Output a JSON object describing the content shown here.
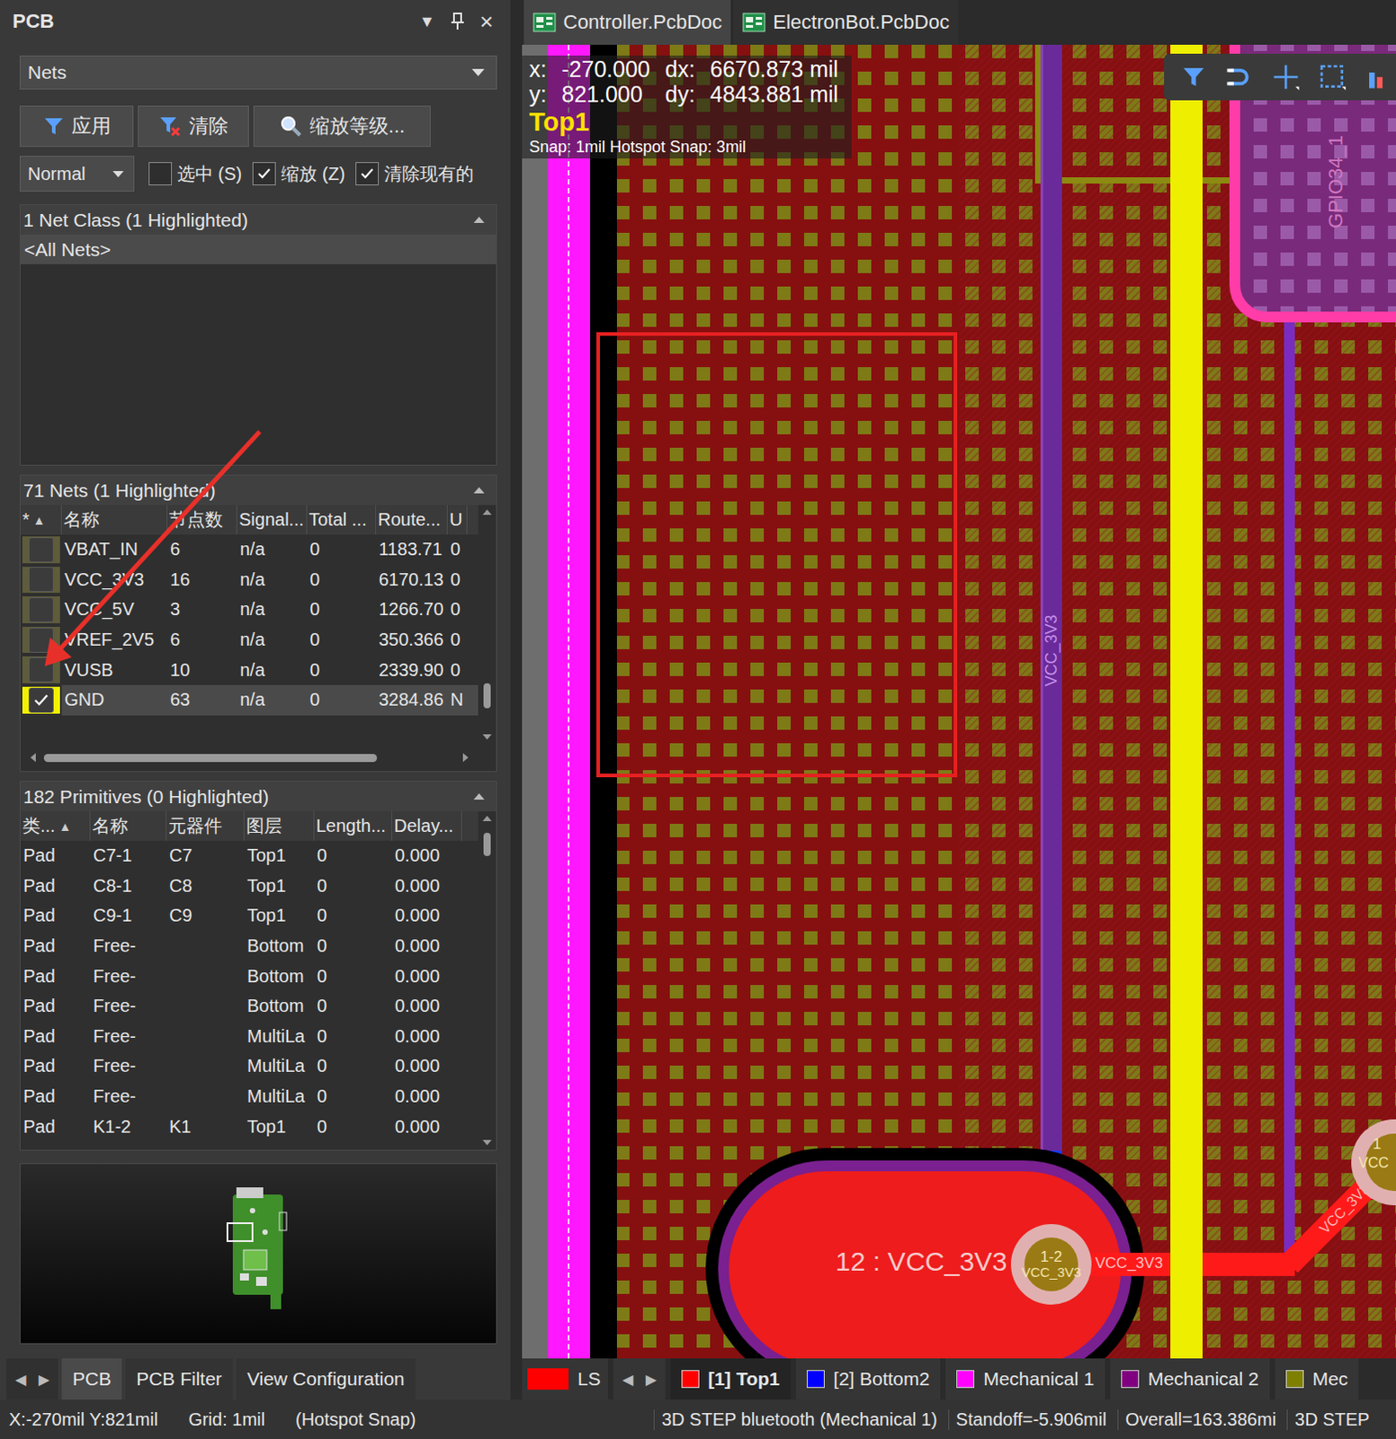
{
  "panel": {
    "title": "PCB",
    "menu_glyph": "▼",
    "close_glyph": "×"
  },
  "mode_dropdown": {
    "value": "Nets"
  },
  "actions": [
    {
      "label": "应用",
      "kind": "filter"
    },
    {
      "label": "清除",
      "kind": "clear"
    },
    {
      "label": "缩放等级...",
      "kind": "zoom"
    }
  ],
  "mask_mode": {
    "value": "Normal"
  },
  "options": [
    {
      "label": "选中 (S)",
      "checked": false
    },
    {
      "label": "缩放 (Z)",
      "checked": true
    },
    {
      "label": "清除现有的",
      "checked": true
    }
  ],
  "net_class_panel": {
    "header": "1 Net Class (1 Highlighted)",
    "items": [
      {
        "label": "<All Nets>",
        "selected": true
      }
    ]
  },
  "nets_panel": {
    "header": "71 Nets (1 Highlighted)",
    "sort_glyph": "▲",
    "columns": [
      {
        "label": "*",
        "sorted": true
      },
      {
        "label": "名称",
        "sorted": false
      },
      {
        "label": "节点数",
        "sorted": false
      },
      {
        "label": "Signal...",
        "sorted": false
      },
      {
        "label": "Total ...",
        "sorted": false
      },
      {
        "label": "Route...",
        "sorted": false
      },
      {
        "label": "U",
        "sorted": false
      }
    ],
    "rows": [
      {
        "cells": [
          "VBAT_IN",
          "6",
          "n/a",
          "0",
          "1183.71",
          "0"
        ],
        "checked": false,
        "selected": false
      },
      {
        "cells": [
          "VCC_3V3",
          "16",
          "n/a",
          "0",
          "6170.13",
          "0"
        ],
        "checked": false,
        "selected": false
      },
      {
        "cells": [
          "VCC_5V",
          "3",
          "n/a",
          "0",
          "1266.70",
          "0"
        ],
        "checked": false,
        "selected": false
      },
      {
        "cells": [
          "VREF_2V5",
          "6",
          "n/a",
          "0",
          "350.366",
          "0"
        ],
        "checked": false,
        "selected": false
      },
      {
        "cells": [
          "VUSB",
          "10",
          "n/a",
          "0",
          "2339.90",
          "0"
        ],
        "checked": false,
        "selected": false
      },
      {
        "cells": [
          "GND",
          "63",
          "n/a",
          "0",
          "3284.86",
          "N"
        ],
        "checked": true,
        "selected": true
      }
    ]
  },
  "primitives_panel": {
    "header": "182 Primitives (0 Highlighted)",
    "sort_glyph": "▲",
    "columns": [
      {
        "label": "类...",
        "sorted": true
      },
      {
        "label": "名称",
        "sorted": false
      },
      {
        "label": "元器件",
        "sorted": false
      },
      {
        "label": "图层",
        "sorted": false
      },
      {
        "label": "Length...",
        "sorted": false
      },
      {
        "label": "Delay...",
        "sorted": false
      }
    ],
    "rows": [
      {
        "cells": [
          "Pad",
          "C7-1",
          "C7",
          "Top1",
          "0",
          "0.000"
        ]
      },
      {
        "cells": [
          "Pad",
          "C8-1",
          "C8",
          "Top1",
          "0",
          "0.000"
        ]
      },
      {
        "cells": [
          "Pad",
          "C9-1",
          "C9",
          "Top1",
          "0",
          "0.000"
        ]
      },
      {
        "cells": [
          "Pad",
          "Free-",
          "",
          "Bottom",
          "0",
          "0.000"
        ]
      },
      {
        "cells": [
          "Pad",
          "Free-",
          "",
          "Bottom",
          "0",
          "0.000"
        ]
      },
      {
        "cells": [
          "Pad",
          "Free-",
          "",
          "Bottom",
          "0",
          "0.000"
        ]
      },
      {
        "cells": [
          "Pad",
          "Free-",
          "",
          "MultiLa",
          "0",
          "0.000"
        ]
      },
      {
        "cells": [
          "Pad",
          "Free-",
          "",
          "MultiLa",
          "0",
          "0.000"
        ]
      },
      {
        "cells": [
          "Pad",
          "Free-",
          "",
          "MultiLa",
          "0",
          "0.000"
        ]
      },
      {
        "cells": [
          "Pad",
          "K1-2",
          "K1",
          "Top1",
          "0",
          "0.000"
        ]
      }
    ]
  },
  "panel_tabs": {
    "nav": [
      "◀",
      "▶"
    ],
    "items": [
      {
        "label": "PCB",
        "selected": true
      },
      {
        "label": "PCB Filter",
        "selected": false
      },
      {
        "label": "View Configuration",
        "selected": false
      }
    ]
  },
  "doc_tabs": [
    {
      "label": "Controller.PcbDoc",
      "selected": true
    },
    {
      "label": "ElectronBot.PcbDoc",
      "selected": false
    }
  ],
  "hud": {
    "x_label": "x:",
    "x": "-270.000",
    "dx_label": "dx:",
    "dx": "6670.873 mil",
    "y_label": "y:",
    "y": "821.000",
    "dy_label": "dy:",
    "dy": "4843.881 mil",
    "layer": "Top1",
    "snap": "Snap: 1mil Hotspot Snap: 3mil"
  },
  "canvas": {
    "track_label": "VCC_3V3",
    "component_label": "GPIO34_1",
    "pad_label": "12 : VCC_3V3",
    "via_number": "1-2",
    "via_net": "VCC_3V3",
    "trace_label": "VCC_3V3",
    "diagonal_label": "VCC_3V3",
    "edge_pad_number": "1",
    "edge_pad_net": "VCC"
  },
  "layer_bar": {
    "current_color": "#ff0000",
    "ls": "LS",
    "nav": [
      "◀",
      "▶"
    ],
    "layers": [
      {
        "label": "[1] Top1",
        "color": "#ff0000",
        "selected": true
      },
      {
        "label": "[2] Bottom2",
        "color": "#0000ff",
        "selected": false
      },
      {
        "label": "Mechanical 1",
        "color": "#ff00ff",
        "selected": false
      },
      {
        "label": "Mechanical 2",
        "color": "#800080",
        "selected": false
      },
      {
        "label": "Mec",
        "color": "#808000",
        "selected": false
      }
    ]
  },
  "status_bar": {
    "coords": "X:-270mil Y:821mil",
    "grid": "Grid: 1mil",
    "snap": "(Hotspot Snap)",
    "info": "3D STEP bluetooth (Mechanical 1)",
    "standoff": "Standoff=-5.906mil",
    "overall": "Overall=163.386mi",
    "tail": "3D STEP"
  }
}
